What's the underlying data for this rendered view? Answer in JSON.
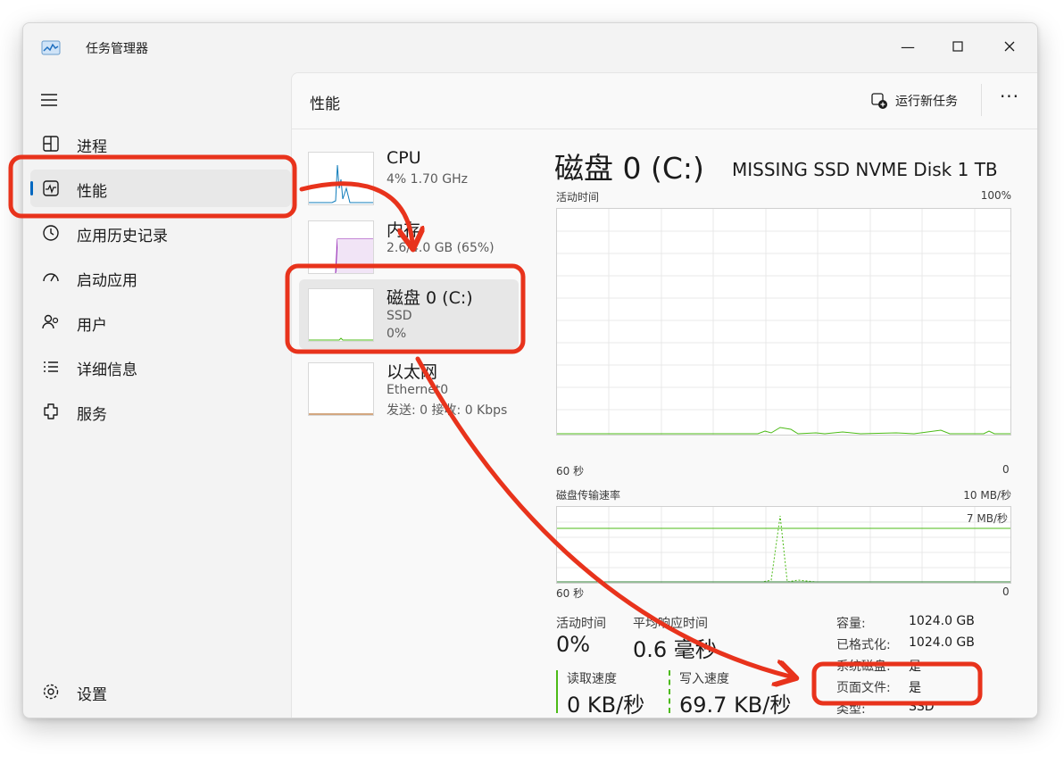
{
  "app": {
    "title": "任务管理器"
  },
  "nav": {
    "items": [
      {
        "label": "进程",
        "icon": "processes-icon"
      },
      {
        "label": "性能",
        "icon": "performance-icon",
        "active": true
      },
      {
        "label": "应用历史记录",
        "icon": "app-history-icon"
      },
      {
        "label": "启动应用",
        "icon": "startup-apps-icon"
      },
      {
        "label": "用户",
        "icon": "users-icon"
      },
      {
        "label": "详细信息",
        "icon": "details-icon"
      },
      {
        "label": "服务",
        "icon": "services-icon"
      }
    ],
    "settings": "设置"
  },
  "header": {
    "title": "性能",
    "run_task": "运行新任务",
    "more": "···"
  },
  "resources": [
    {
      "name": "CPU",
      "sub1": "4% 1.70 GHz",
      "sub2": ""
    },
    {
      "name": "内存",
      "sub1": "2.6/4.0 GB (65%)",
      "sub2": ""
    },
    {
      "name": "磁盘 0 (C:)",
      "sub1": "SSD",
      "sub2": "0%"
    },
    {
      "name": "以太网",
      "sub1": "Ethernet0",
      "sub2": "发送: 0 接收: 0 Kbps"
    }
  ],
  "disk": {
    "title": "磁盘 0 (C:)",
    "model": "MISSING SSD NVME Disk 1 TB",
    "graph1": {
      "label": "活动时间",
      "max": "100%",
      "left": "60 秒",
      "right": "0"
    },
    "graph2": {
      "label": "磁盘传输速率",
      "max": "10 MB/秒",
      "ref": "7 MB/秒",
      "left": "60 秒",
      "right": "0"
    },
    "stats": {
      "active_time_label": "活动时间",
      "active_time": "0%",
      "avg_response_label": "平均响应时间",
      "avg_response": "0.6 毫秒",
      "read_label": "读取速度",
      "read": "0 KB/秒",
      "write_label": "写入速度",
      "write": "69.7 KB/秒"
    },
    "props": [
      {
        "k": "容量:",
        "v": "1024.0 GB"
      },
      {
        "k": "已格式化:",
        "v": "1024.0 GB"
      },
      {
        "k": "系统磁盘:",
        "v": "是"
      },
      {
        "k": "页面文件:",
        "v": "是"
      },
      {
        "k": "类型:",
        "v": "SSD"
      }
    ]
  },
  "colors": {
    "accent": "#0067c0",
    "disk_green": "#4cbb17",
    "annotation_red": "#e8331c"
  }
}
